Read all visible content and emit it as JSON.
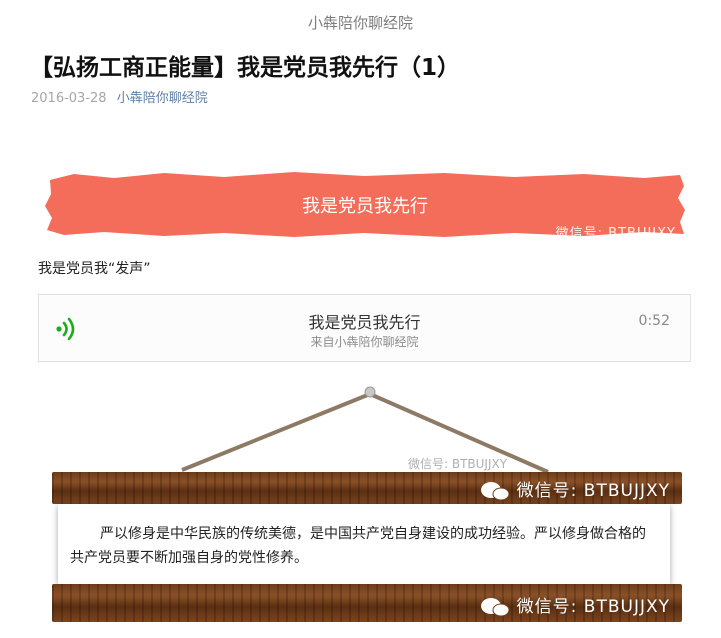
{
  "header": {
    "account_name": "小犇陪你聊经院"
  },
  "article": {
    "title": "【弘扬工商正能量】我是党员我先行（1）",
    "date": "2016-03-28",
    "author": "小犇陪你聊经院"
  },
  "banner": {
    "title": "我是党员我先行",
    "watermark": "微信号: BTBUJJXY",
    "color": "#f36d5a"
  },
  "voice_intro": "我是党员我“发声”",
  "voice": {
    "title": "我是党员我先行",
    "from": "来自小犇陪你聊经院",
    "duration": "0:52",
    "icon": "voice-wave-icon",
    "icon_color": "#1aad19"
  },
  "sign": {
    "small_watermark": "微信号: BTBUJJXY",
    "top_watermark": "微信号: BTBUJJXY",
    "bottom_watermark": "微信号: BTBUJJXY",
    "text": "严以修身是中华民族的传统美德，是中国共产党自身建设的成功经验。严以修身做合格的共产党员要不断加强自身的党性修养。"
  }
}
